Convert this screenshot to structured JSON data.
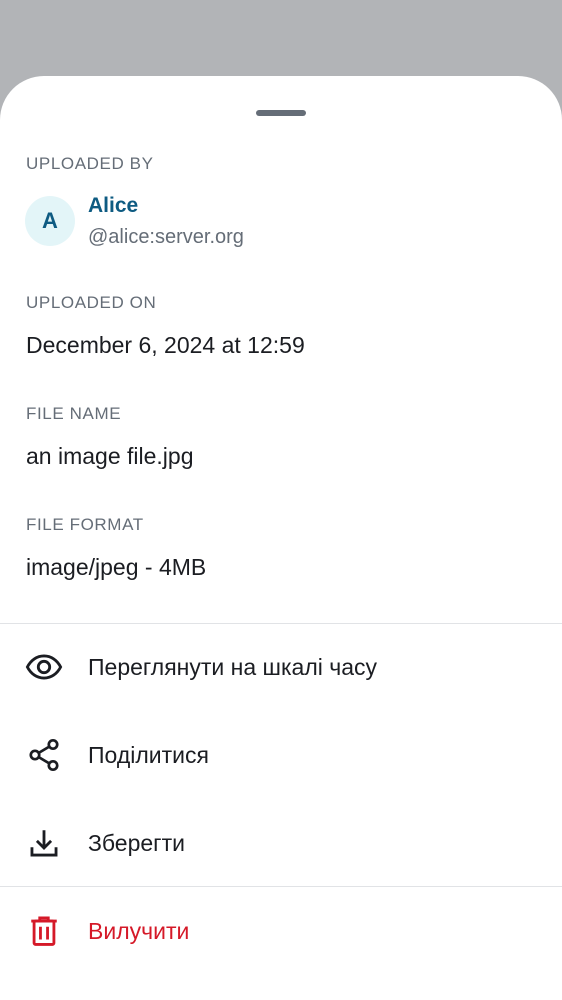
{
  "uploaded_by": {
    "label": "UPLOADED BY",
    "avatar_initial": "A",
    "name": "Alice",
    "user_id": "@alice:server.org"
  },
  "uploaded_on": {
    "label": "UPLOADED ON",
    "value": "December 6, 2024 at 12:59"
  },
  "file_name": {
    "label": "FILE NAME",
    "value": "an image file.jpg"
  },
  "file_format": {
    "label": "FILE FORMAT",
    "value": "image/jpeg - 4MB"
  },
  "actions": [
    {
      "label": "Переглянути на шкалі часу",
      "icon": "eye-icon"
    },
    {
      "label": "Поділитися",
      "icon": "share-icon"
    },
    {
      "label": "Зберегти",
      "icon": "download-icon"
    },
    {
      "label": "Вилучити",
      "icon": "trash-icon"
    }
  ],
  "colors": {
    "accent": "#0e5b82",
    "danger": "#d51928",
    "secondary_text": "#656d77",
    "primary_text": "#1b1d22",
    "scrim": "#b2b4b7"
  }
}
